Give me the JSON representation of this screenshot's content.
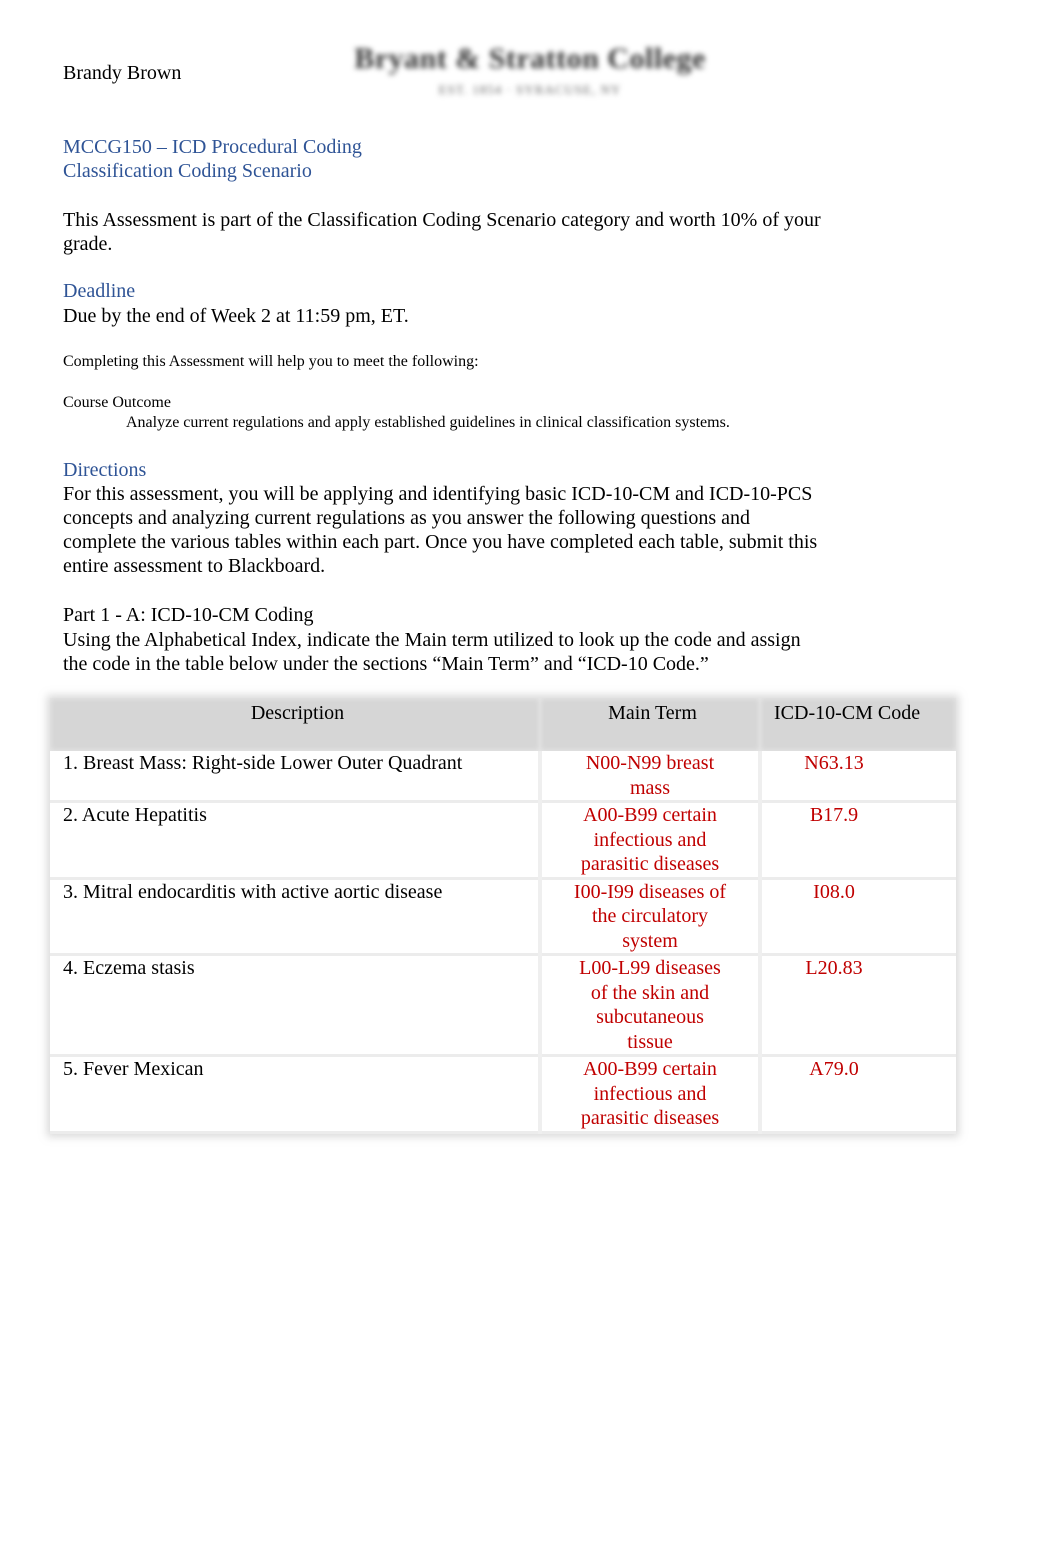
{
  "header": {
    "student_name": "Brandy Brown",
    "logo_title": "Bryant & Stratton College",
    "logo_subtitle": "EST. 1854 · SYRACUSE, NY"
  },
  "course": {
    "title_line1": "MCCG150 – ICD Procedural Coding",
    "title_line2": "Classification Coding Scenario"
  },
  "intro": "This Assessment is part of the Classification Coding Scenario category and worth 10% of your grade.",
  "deadline": {
    "heading": "Deadline",
    "text": "Due by the end of Week 2 at 11:59 pm, ET."
  },
  "completing_text": "Completing this Assessment will help you to meet the following:",
  "course_outcome": {
    "label": "Course Outcome",
    "bullet_glyph": "",
    "items": [
      "Analyze current regulations and apply established guidelines in clinical classification systems."
    ]
  },
  "directions": {
    "heading": "Directions",
    "text": "For this assessment, you will be applying and identifying basic ICD-10-CM and ICD-10-PCS concepts and analyzing current regulations as you answer the following questions and complete the various tables within each part. Once you have completed each table, submit this entire assessment to Blackboard."
  },
  "part1": {
    "title": "Part 1 - A: ICD-10-CM Coding",
    "description": "Using the Alphabetical Index, indicate the Main term utilized to look up the code and assign the code in the table below under the sections “Main Term” and “ICD-10 Code.”",
    "table": {
      "headers": [
        "Description",
        "Main Term",
        "ICD-10-CM Code"
      ],
      "rows": [
        {
          "description": "1. Breast Mass: Right-side Lower Outer Quadrant",
          "main_term": "N00-N99 breast mass",
          "code": "N63.13"
        },
        {
          "description": "2. Acute Hepatitis",
          "main_term": "A00-B99 certain infectious and parasitic diseases",
          "code": "B17.9"
        },
        {
          "description": "3. Mitral endocarditis with active aortic disease",
          "main_term": "I00-I99 diseases of the circulatory system",
          "code": "I08.0"
        },
        {
          "description": "4. Eczema stasis",
          "main_term": "L00-L99 diseases of the skin and subcutaneous tissue",
          "code": "L20.83"
        },
        {
          "description": "5. Fever Mexican",
          "main_term": "A00-B99 certain infectious and parasitic diseases",
          "code": "A79.0"
        }
      ]
    }
  },
  "colors": {
    "heading_blue": "#2f5496",
    "answer_red": "#c00000",
    "table_header_gray": "#d6d6d6"
  }
}
